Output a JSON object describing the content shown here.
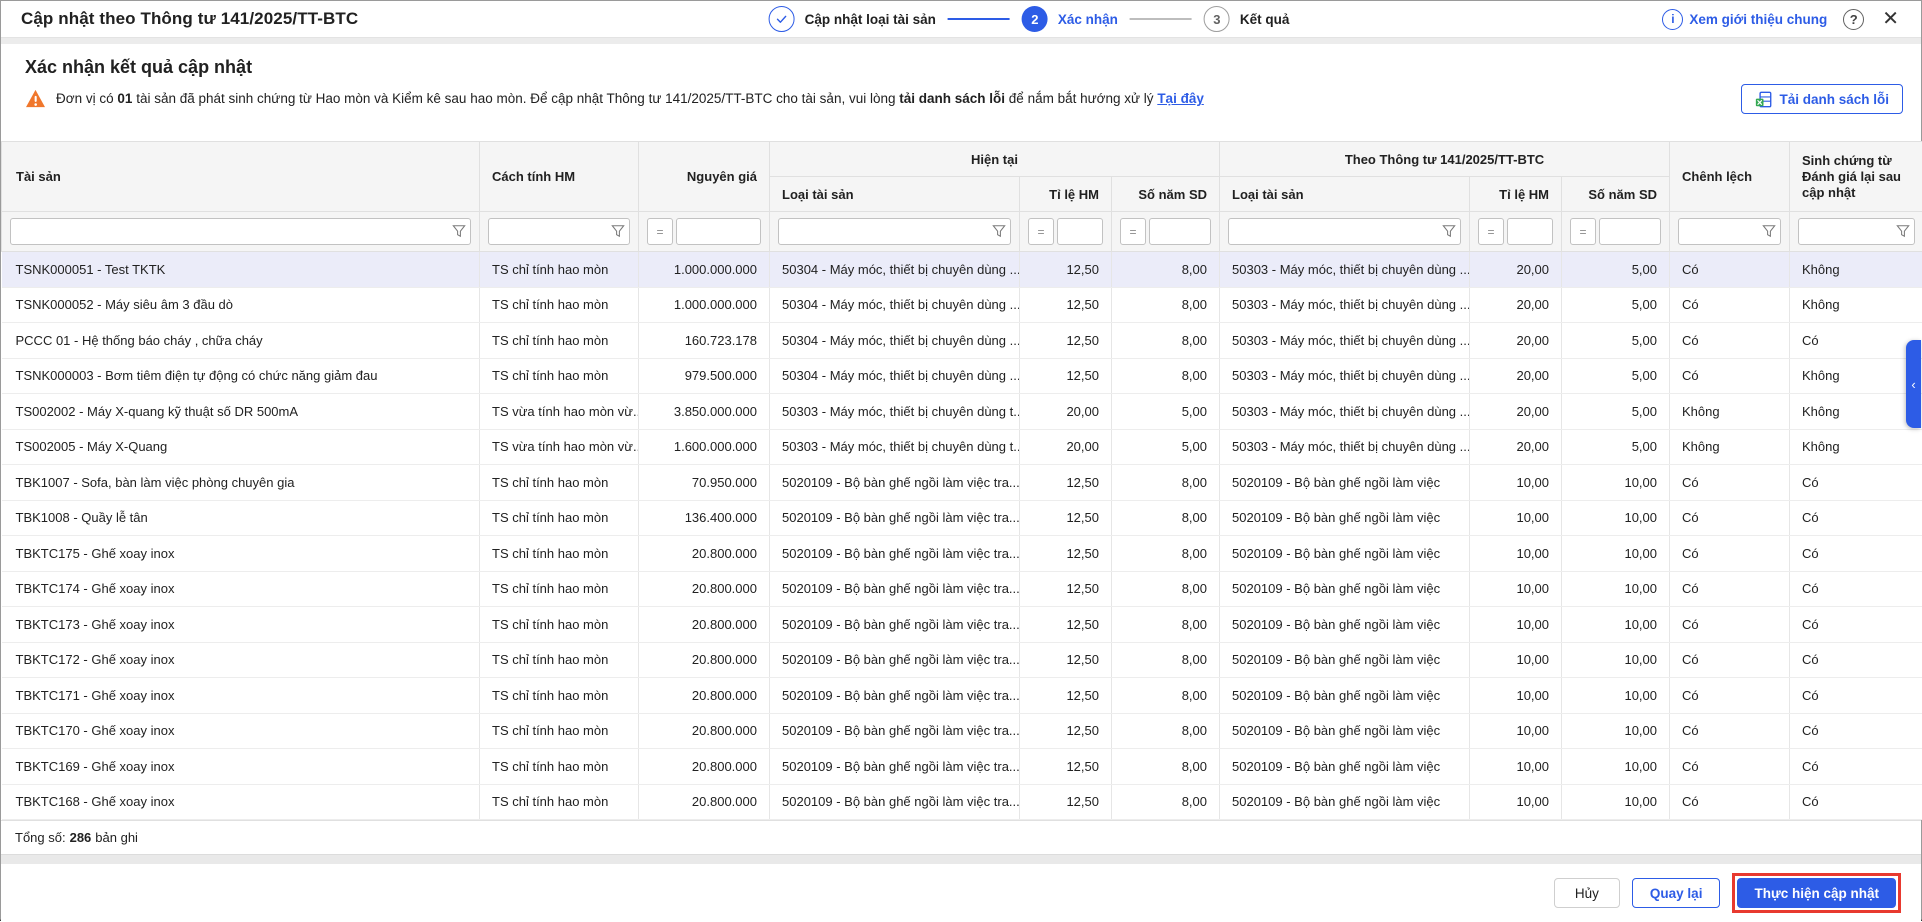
{
  "header": {
    "title": "Cập nhật theo Thông tư 141/2025/TT-BTC",
    "steps": [
      {
        "label": "Cập nhật loại tài sản",
        "state": "done"
      },
      {
        "num": "2",
        "label": "Xác nhận",
        "state": "active"
      },
      {
        "num": "3",
        "label": "Kết quả",
        "state": "pending"
      }
    ],
    "intro_link": "Xem giới thiệu chung"
  },
  "section": {
    "title": "Xác nhận kết quả cập nhật",
    "warning": {
      "part1": "Đơn vị có",
      "bold1": "01",
      "part2": "tài sản đã phát sinh chứng từ Hao mòn và Kiểm kê sau hao mòn. Để cập nhật Thông tư 141/2025/TT-BTC cho tài sản, vui lòng",
      "bold2": "tải danh sách lỗi",
      "part3": "để nắm bắt hướng xử lý",
      "link": "Tại đây"
    },
    "download_button": "Tải danh sách lỗi"
  },
  "table": {
    "headers": {
      "asset": "Tài sản",
      "method": "Cách tính HM",
      "cost": "Nguyên giá",
      "group_current": "Hiện tại",
      "group_new": "Theo Thông tư 141/2025/TT-BTC",
      "type": "Loại tài sản",
      "rate": "Tỉ lệ HM",
      "years": "Số năm SD",
      "diff": "Chênh lệch",
      "gen": "Sinh chứng từ Đánh giá lại sau cập nhật"
    },
    "rows": [
      {
        "selected": true,
        "name": "TSNK000051 - Test TKTK",
        "method": "TS chỉ tính hao mòn",
        "cost": "1.000.000.000",
        "cur_type": "50304 - Máy móc, thiết bị chuyên dùng ...",
        "cur_rate": "12,50",
        "cur_years": "8,00",
        "new_type": "50303 - Máy móc, thiết bị chuyên dùng ...",
        "new_rate": "20,00",
        "new_years": "5,00",
        "diff": "Có",
        "gen_doc": "Không"
      },
      {
        "selected": false,
        "name": "TSNK000052 - Máy siêu âm 3 đầu dò",
        "method": "TS chỉ tính hao mòn",
        "cost": "1.000.000.000",
        "cur_type": "50304 - Máy móc, thiết bị chuyên dùng ...",
        "cur_rate": "12,50",
        "cur_years": "8,00",
        "new_type": "50303 - Máy móc, thiết bị chuyên dùng ...",
        "new_rate": "20,00",
        "new_years": "5,00",
        "diff": "Có",
        "gen_doc": "Không"
      },
      {
        "selected": false,
        "name": "PCCC 01 - Hệ thống báo cháy , chữa cháy",
        "method": "TS chỉ tính hao mòn",
        "cost": "160.723.178",
        "cur_type": "50304 - Máy móc, thiết bị chuyên dùng ...",
        "cur_rate": "12,50",
        "cur_years": "8,00",
        "new_type": "50303 - Máy móc, thiết bị chuyên dùng ...",
        "new_rate": "20,00",
        "new_years": "5,00",
        "diff": "Có",
        "gen_doc": "Có"
      },
      {
        "selected": false,
        "name": "TSNK000003 - Bơm tiêm điện tự động có chức năng giảm đau",
        "method": "TS chỉ tính hao mòn",
        "cost": "979.500.000",
        "cur_type": "50304 - Máy móc, thiết bị chuyên dùng ...",
        "cur_rate": "12,50",
        "cur_years": "8,00",
        "new_type": "50303 - Máy móc, thiết bị chuyên dùng ...",
        "new_rate": "20,00",
        "new_years": "5,00",
        "diff": "Có",
        "gen_doc": "Không"
      },
      {
        "selected": false,
        "name": "TS002002 - Máy X-quang kỹ thuật số DR 500mA",
        "method": "TS vừa tính hao mòn vừ...",
        "cost": "3.850.000.000",
        "cur_type": "50303 - Máy móc, thiết bị chuyên dùng t...",
        "cur_rate": "20,00",
        "cur_years": "5,00",
        "new_type": "50303 - Máy móc, thiết bị chuyên dùng ...",
        "new_rate": "20,00",
        "new_years": "5,00",
        "diff": "Không",
        "gen_doc": "Không"
      },
      {
        "selected": false,
        "name": "TS002005 - Máy X-Quang",
        "method": "TS vừa tính hao mòn vừ...",
        "cost": "1.600.000.000",
        "cur_type": "50303 - Máy móc, thiết bị chuyên dùng t...",
        "cur_rate": "20,00",
        "cur_years": "5,00",
        "new_type": "50303 - Máy móc, thiết bị chuyên dùng ...",
        "new_rate": "20,00",
        "new_years": "5,00",
        "diff": "Không",
        "gen_doc": "Không"
      },
      {
        "selected": false,
        "name": "TBK1007 - Sofa, bàn làm việc phòng chuyên gia",
        "method": "TS chỉ tính hao mòn",
        "cost": "70.950.000",
        "cur_type": "5020109 - Bộ bàn ghế ngồi làm việc tra...",
        "cur_rate": "12,50",
        "cur_years": "8,00",
        "new_type": "5020109 - Bộ bàn ghế ngồi làm việc",
        "new_rate": "10,00",
        "new_years": "10,00",
        "diff": "Có",
        "gen_doc": "Có"
      },
      {
        "selected": false,
        "name": "TBK1008 - Quầy lễ tân",
        "method": "TS chỉ tính hao mòn",
        "cost": "136.400.000",
        "cur_type": "5020109 - Bộ bàn ghế ngồi làm việc tra...",
        "cur_rate": "12,50",
        "cur_years": "8,00",
        "new_type": "5020109 - Bộ bàn ghế ngồi làm việc",
        "new_rate": "10,00",
        "new_years": "10,00",
        "diff": "Có",
        "gen_doc": "Có"
      },
      {
        "selected": false,
        "name": "TBKTC175 - Ghế xoay inox",
        "method": "TS chỉ tính hao mòn",
        "cost": "20.800.000",
        "cur_type": "5020109 - Bộ bàn ghế ngồi làm việc tra...",
        "cur_rate": "12,50",
        "cur_years": "8,00",
        "new_type": "5020109 - Bộ bàn ghế ngồi làm việc",
        "new_rate": "10,00",
        "new_years": "10,00",
        "diff": "Có",
        "gen_doc": "Có"
      },
      {
        "selected": false,
        "name": "TBKTC174 - Ghế xoay inox",
        "method": "TS chỉ tính hao mòn",
        "cost": "20.800.000",
        "cur_type": "5020109 - Bộ bàn ghế ngồi làm việc tra...",
        "cur_rate": "12,50",
        "cur_years": "8,00",
        "new_type": "5020109 - Bộ bàn ghế ngồi làm việc",
        "new_rate": "10,00",
        "new_years": "10,00",
        "diff": "Có",
        "gen_doc": "Có"
      },
      {
        "selected": false,
        "name": "TBKTC173 - Ghế xoay inox",
        "method": "TS chỉ tính hao mòn",
        "cost": "20.800.000",
        "cur_type": "5020109 - Bộ bàn ghế ngồi làm việc tra...",
        "cur_rate": "12,50",
        "cur_years": "8,00",
        "new_type": "5020109 - Bộ bàn ghế ngồi làm việc",
        "new_rate": "10,00",
        "new_years": "10,00",
        "diff": "Có",
        "gen_doc": "Có"
      },
      {
        "selected": false,
        "name": "TBKTC172 - Ghế xoay inox",
        "method": "TS chỉ tính hao mòn",
        "cost": "20.800.000",
        "cur_type": "5020109 - Bộ bàn ghế ngồi làm việc tra...",
        "cur_rate": "12,50",
        "cur_years": "8,00",
        "new_type": "5020109 - Bộ bàn ghế ngồi làm việc",
        "new_rate": "10,00",
        "new_years": "10,00",
        "diff": "Có",
        "gen_doc": "Có"
      },
      {
        "selected": false,
        "name": "TBKTC171 - Ghế xoay inox",
        "method": "TS chỉ tính hao mòn",
        "cost": "20.800.000",
        "cur_type": "5020109 - Bộ bàn ghế ngồi làm việc tra...",
        "cur_rate": "12,50",
        "cur_years": "8,00",
        "new_type": "5020109 - Bộ bàn ghế ngồi làm việc",
        "new_rate": "10,00",
        "new_years": "10,00",
        "diff": "Có",
        "gen_doc": "Có"
      },
      {
        "selected": false,
        "name": "TBKTC170 - Ghế xoay inox",
        "method": "TS chỉ tính hao mòn",
        "cost": "20.800.000",
        "cur_type": "5020109 - Bộ bàn ghế ngồi làm việc tra...",
        "cur_rate": "12,50",
        "cur_years": "8,00",
        "new_type": "5020109 - Bộ bàn ghế ngồi làm việc",
        "new_rate": "10,00",
        "new_years": "10,00",
        "diff": "Có",
        "gen_doc": "Có"
      },
      {
        "selected": false,
        "name": "TBKTC169 - Ghế xoay inox",
        "method": "TS chỉ tính hao mòn",
        "cost": "20.800.000",
        "cur_type": "5020109 - Bộ bàn ghế ngồi làm việc tra...",
        "cur_rate": "12,50",
        "cur_years": "8,00",
        "new_type": "5020109 - Bộ bàn ghế ngồi làm việc",
        "new_rate": "10,00",
        "new_years": "10,00",
        "diff": "Có",
        "gen_doc": "Có"
      },
      {
        "selected": false,
        "name": "TBKTC168 - Ghế xoay inox",
        "method": "TS chỉ tính hao mòn",
        "cost": "20.800.000",
        "cur_type": "5020109 - Bộ bàn ghế ngồi làm việc tra...",
        "cur_rate": "12,50",
        "cur_years": "8,00",
        "new_type": "5020109 - Bộ bàn ghế ngồi làm việc",
        "new_rate": "10,00",
        "new_years": "10,00",
        "diff": "Có",
        "gen_doc": "Có"
      }
    ]
  },
  "footer": {
    "total_label": "Tổng số:",
    "total_count": "286",
    "total_suffix": "bản ghi",
    "buttons": {
      "cancel": "Hủy",
      "back": "Quay lại",
      "submit": "Thực hiện cập nhật"
    }
  }
}
